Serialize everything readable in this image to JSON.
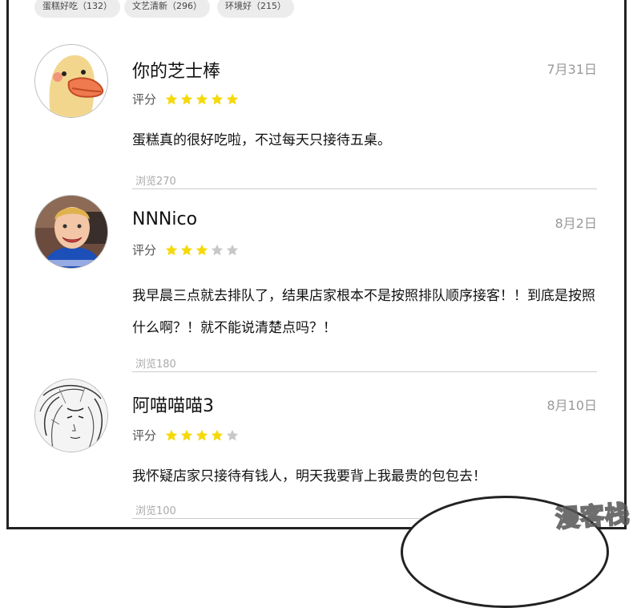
{
  "tags": [
    {
      "label": "蛋糕好吃（132）"
    },
    {
      "label": "文艺清新（296）"
    },
    {
      "label": "环境好（215）"
    }
  ],
  "rating_label": "评分",
  "reviews": [
    {
      "username": "你的芝士棒",
      "date": "7月31日",
      "rating": 5,
      "text": "蛋糕真的很好吃啦，不过每天只接待五桌。",
      "views": "浏览270",
      "avatar": "duck-cartoon-avatar"
    },
    {
      "username": "NNNico",
      "date": "8月2日",
      "rating": 3,
      "text": "我早晨三点就去排队了，结果店家根本不是按照排队顺序接客！！到底是按照什么啊？！就不能说清楚点吗？！",
      "views": "浏览180",
      "avatar": "boy-photo-avatar"
    },
    {
      "username": "阿喵喵喵3",
      "date": "8月10日",
      "rating": 4,
      "text": "我怀疑店家只接待有钱人，明天我要背上我最贵的包包去！",
      "views": "浏览100",
      "avatar": "sketch-girl-avatar"
    }
  ],
  "watermark": "漫客栈",
  "colors": {
    "star_on": "#f5d90a",
    "star_off": "#c8c8c8",
    "border": "#222222"
  }
}
